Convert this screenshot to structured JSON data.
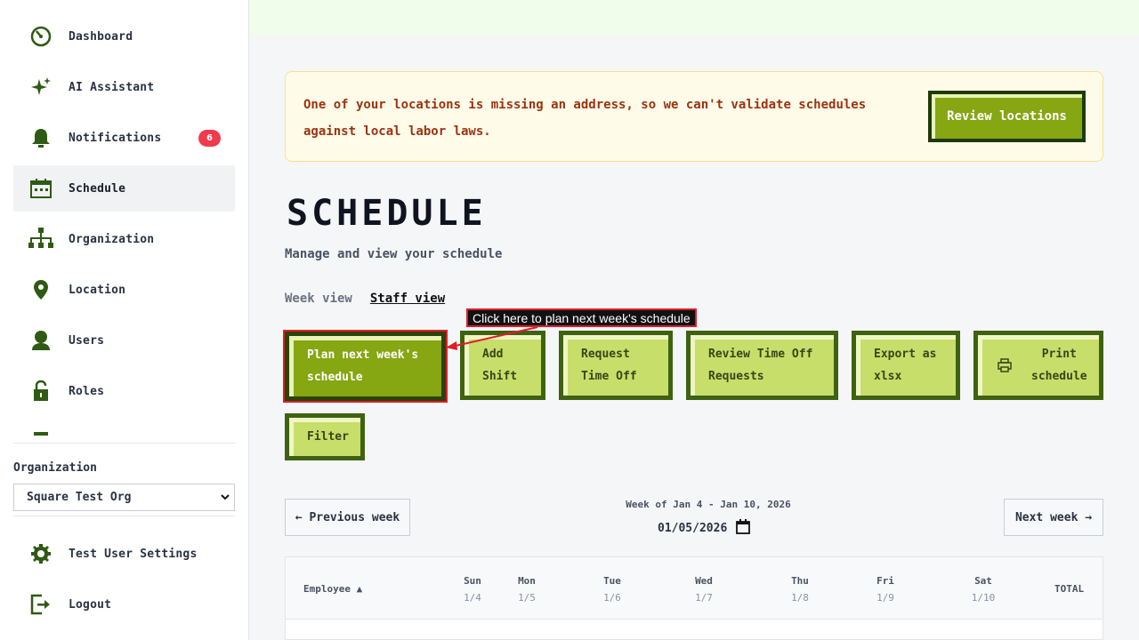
{
  "sidebar": {
    "items": [
      {
        "label": "Dashboard",
        "icon": "dashboard-icon"
      },
      {
        "label": "AI Assistant",
        "icon": "sparkle-icon"
      },
      {
        "label": "Notifications",
        "icon": "bell-icon",
        "badge": "6"
      },
      {
        "label": "Schedule",
        "icon": "calendar-icon",
        "active": true
      },
      {
        "label": "Organization",
        "icon": "org-chart-icon"
      },
      {
        "label": "Location",
        "icon": "location-pin-icon"
      },
      {
        "label": "Users",
        "icon": "user-icon"
      },
      {
        "label": "Roles",
        "icon": "lock-icon"
      }
    ],
    "org_label": "Organization",
    "org_selected": "Square Test Org",
    "settings_label": "Test User Settings",
    "logout_label": "Logout"
  },
  "alert": {
    "message": "One of your locations is missing an address, so we can't validate schedules against local labor laws.",
    "button_label": "Review locations"
  },
  "page": {
    "title": "SCHEDULE",
    "subtitle": "Manage and view your schedule",
    "views": [
      "Week view",
      "Staff view"
    ],
    "active_view": "Staff view"
  },
  "actions": {
    "plan_next_week": "Plan next week's\nschedule",
    "add_shift": "Add\nShift",
    "request_time_off": "Request\nTime Off",
    "review_time_off": "Review Time Off\nRequests",
    "export_xlsx": "Export as\nxlsx",
    "print_schedule": "Print\nschedule",
    "filter": "Filter"
  },
  "tooltip": "Click here to plan next week's schedule",
  "week_nav": {
    "previous": "← Previous week",
    "next": "Next week →",
    "range": "Week of Jan 4 - Jan 10, 2026",
    "date_value": "01/05/2026"
  },
  "table": {
    "employee_header": "Employee ▲",
    "days": [
      {
        "day": "Sun",
        "date": "1/4"
      },
      {
        "day": "Mon",
        "date": "1/5"
      },
      {
        "day": "Tue",
        "date": "1/6"
      },
      {
        "day": "Wed",
        "date": "1/7"
      },
      {
        "day": "Thu",
        "date": "1/8"
      },
      {
        "day": "Fri",
        "date": "1/9"
      },
      {
        "day": "Sat",
        "date": "1/10"
      }
    ],
    "total_header": "TOTAL"
  },
  "colors": {
    "primary": "#86a612",
    "secondary_btn": "#c8de6a",
    "border_dark": "#3f6212",
    "alert_text": "#9a3412",
    "badge": "#ef3b4b",
    "highlight": "#e11d2a"
  }
}
